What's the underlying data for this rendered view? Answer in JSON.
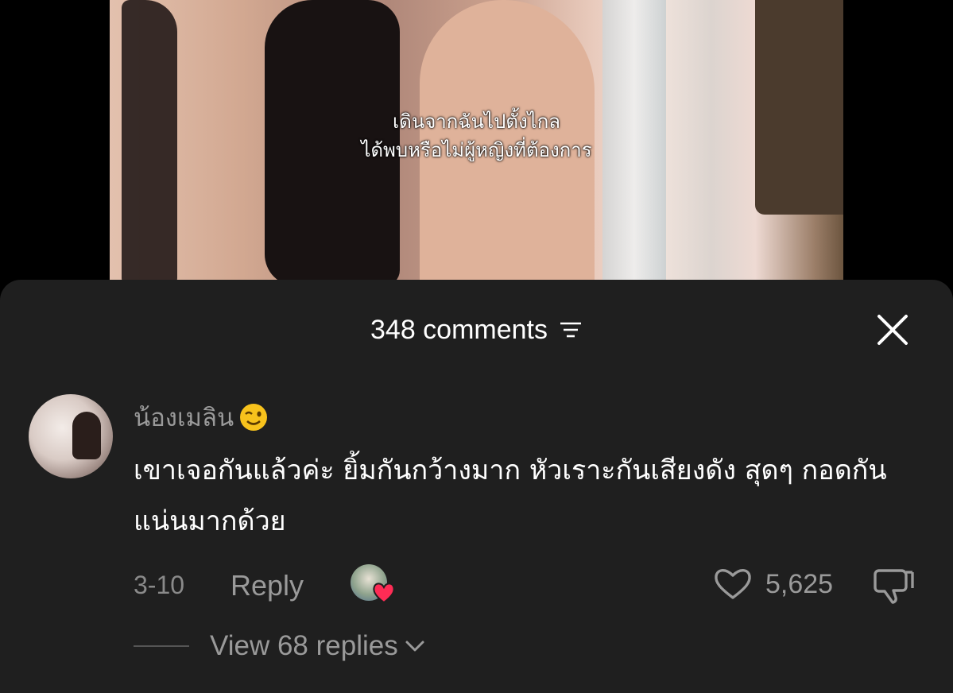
{
  "video": {
    "subtitle_line1": "เดินจากฉันไปตั้งไกล",
    "subtitle_line2": "ได้พบหรือไม่ผู้หญิงที่ต้องการ"
  },
  "comments_panel": {
    "count_label": "348 comments",
    "filter_icon": "filter-lines-icon",
    "close_icon": "close-x-icon"
  },
  "comment": {
    "username": "น้องเมลิน",
    "username_emoji": "winking-face",
    "text": "เขาเจอกันแล้วค่ะ ยิ้มกันกว้างมาก หัวเราะกันเสียงดัง สุดๆ กอดกันแน่นมากด้วย",
    "date": "3-10",
    "reply_label": "Reply",
    "like_count": "5,625",
    "view_replies_label": "View 68 replies"
  },
  "colors": {
    "sheet_bg": "#1f1f1f",
    "muted_text": "#9a9a9a",
    "heart_red": "#fe2c55"
  }
}
